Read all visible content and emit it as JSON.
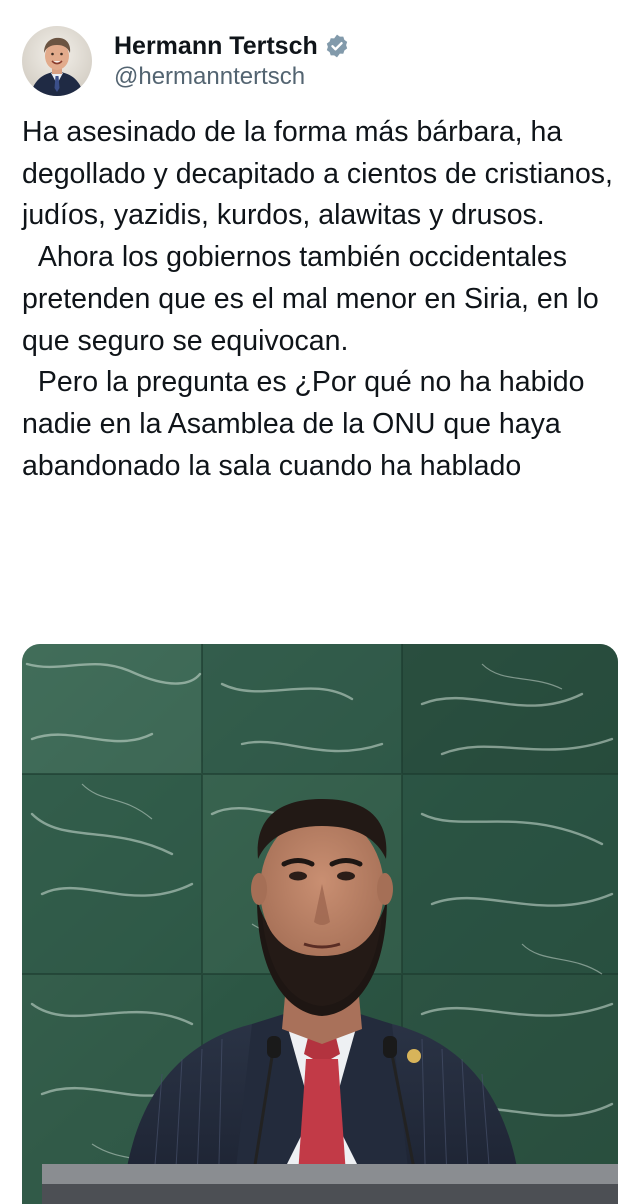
{
  "tweet": {
    "author": {
      "name": "Hermann Tertsch",
      "handle": "@hermanntertsch",
      "verified": true,
      "avatar_icon": "profile-photo",
      "verified_icon": "verified-badge-icon"
    },
    "paragraphs": [
      "Ha asesinado de la forma más bárbara, ha degollado y decapitado a cientos de cristianos, judíos, yazidis, kurdos, alawitas y drusos.",
      "  Ahora los gobiernos también occidentales pretenden que es el mal menor en Siria, en lo que seguro se equivocan.",
      "  Pero la pregunta es ¿Por qué no ha habido nadie en la Asamblea de la ONU que haya abandonado la sala cuando ha hablado"
    ],
    "media": {
      "type": "photo",
      "description_icon": "speaker-at-podium-photo"
    }
  },
  "colors": {
    "text": "#0f1419",
    "secondary_text": "#536471",
    "verified_badge": "#829aab",
    "marble_green": "#2f5a47"
  }
}
